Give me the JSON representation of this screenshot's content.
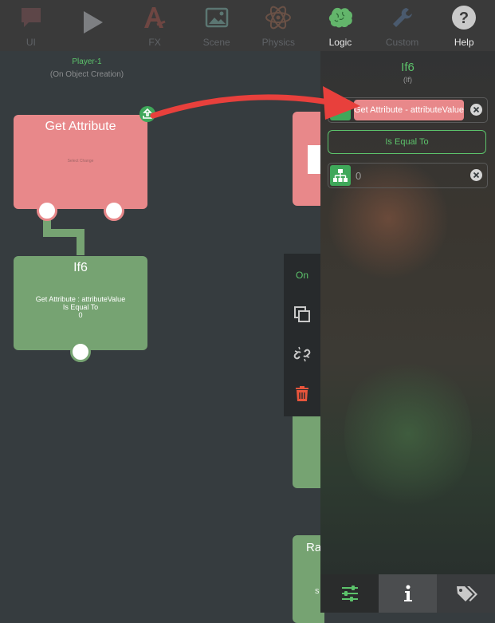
{
  "toolbar": {
    "items": [
      {
        "label": "UI",
        "icon": "speech-bubble-icon"
      },
      {
        "label": "",
        "icon": "play-icon"
      },
      {
        "label": "FX",
        "icon": "fx-icon"
      },
      {
        "label": "Scene",
        "icon": "image-icon"
      },
      {
        "label": "Physics",
        "icon": "atom-icon"
      },
      {
        "label": "Logic",
        "icon": "brain-icon",
        "active": true
      },
      {
        "label": "Custom",
        "icon": "wrench-icon"
      },
      {
        "label": "Help",
        "icon": "help-icon"
      }
    ]
  },
  "canvas": {
    "object_name": "Player-1",
    "trigger": "(On Object Creation)",
    "get_attribute_node": {
      "title": "Get Attribute",
      "detail": "Select Change"
    },
    "if_node": {
      "title": "If6",
      "line1": "Get Attribute : attributeValue",
      "line2": "Is Equal To",
      "line3": "0"
    },
    "partial_node": {
      "title_fragment": "Ra",
      "line_fragment": "S"
    }
  },
  "actions": {
    "on_label": "On"
  },
  "panel": {
    "title": "If6",
    "subtitle": "(If)",
    "attribute_value": "Get Attribute - attributeValue",
    "operator": "Is Equal To",
    "compare_value": "0"
  },
  "colors": {
    "accent": "#5cc36b",
    "node_red": "#e8888a",
    "node_green": "#76a372",
    "arrow": "#e8403c"
  }
}
